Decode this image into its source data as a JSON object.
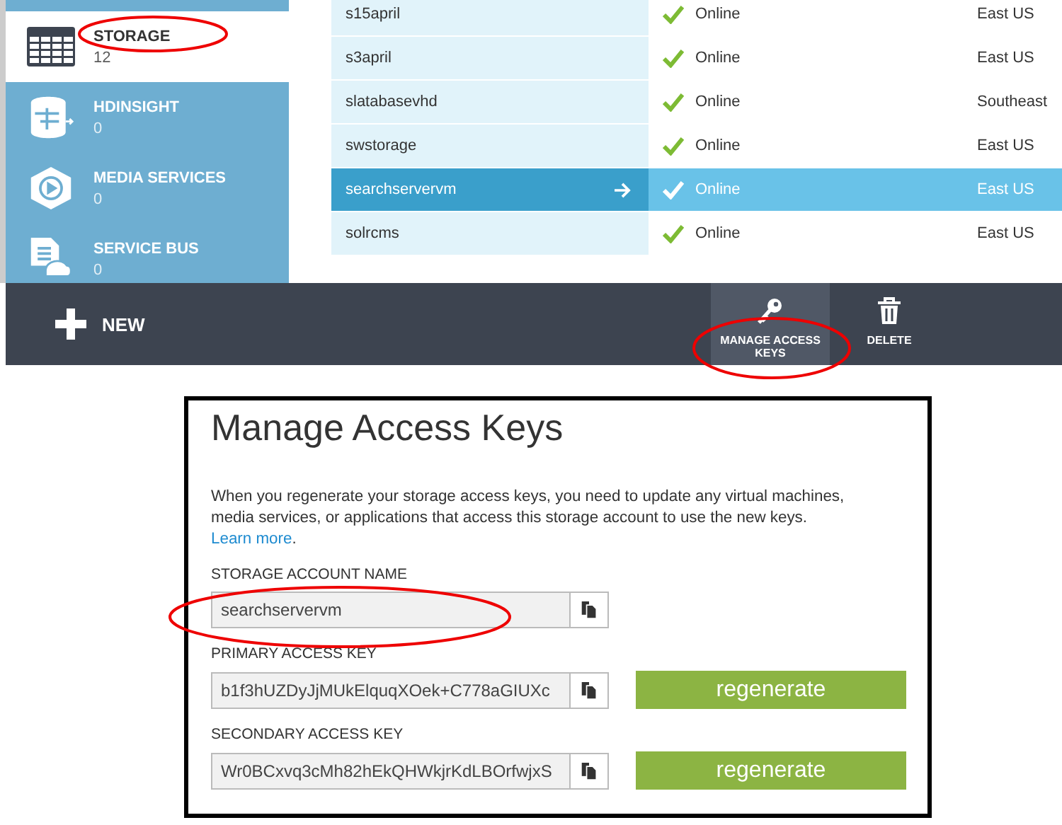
{
  "sidebar": {
    "items": [
      {
        "label": "STORAGE",
        "count": "12",
        "selected": true
      },
      {
        "label": "HDINSIGHT",
        "count": "0",
        "selected": false
      },
      {
        "label": "MEDIA SERVICES",
        "count": "0",
        "selected": false
      },
      {
        "label": "SERVICE BUS",
        "count": "0",
        "selected": false
      }
    ]
  },
  "table": {
    "rows": [
      {
        "name": "s15april",
        "status": "Online",
        "location": "East US",
        "selected": false
      },
      {
        "name": "s3april",
        "status": "Online",
        "location": "East US",
        "selected": false
      },
      {
        "name": "slatabasevhd",
        "status": "Online",
        "location": "Southeast",
        "selected": false
      },
      {
        "name": "swstorage",
        "status": "Online",
        "location": "East US",
        "selected": false
      },
      {
        "name": "searchservervm",
        "status": "Online",
        "location": "East US",
        "selected": true
      },
      {
        "name": "solrcms",
        "status": "Online",
        "location": "East US",
        "selected": false
      }
    ]
  },
  "command_bar": {
    "new_label": "NEW",
    "actions": [
      {
        "kind": "key",
        "label": "MANAGE ACCESS KEYS",
        "selected": true
      },
      {
        "kind": "trash",
        "label": "DELETE",
        "selected": false
      }
    ]
  },
  "dialog": {
    "title": "Manage Access Keys",
    "description": "When you regenerate your storage access keys, you need to update any virtual machines, media services, or applications that access this storage account to use the new keys.",
    "link": "Learn more",
    "link_after": ".",
    "fields": [
      {
        "label": "STORAGE ACCOUNT NAME",
        "value": "searchservervm"
      },
      {
        "label": "PRIMARY ACCESS KEY",
        "value": "b1f3hUZDyJjMUkElquqXOek+C778aGIUXc",
        "button": "regenerate"
      },
      {
        "label": "SECONDARY ACCESS KEY",
        "value": "Wr0BCxvq3cMh82hEkQHWkjrKdLBOrfwjxS",
        "button": "regenerate"
      }
    ]
  }
}
